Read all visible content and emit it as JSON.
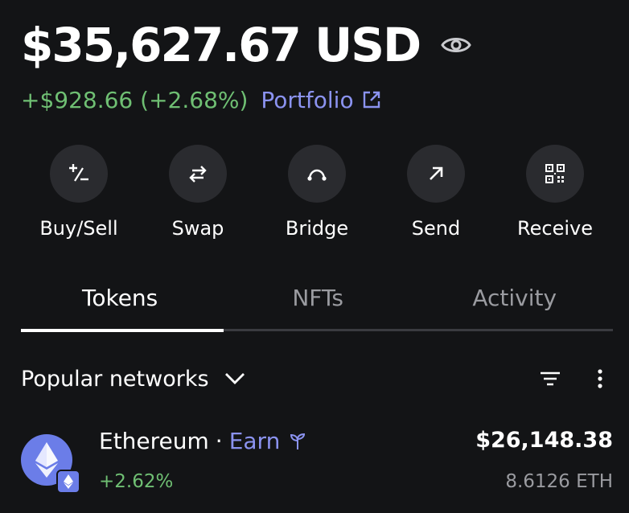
{
  "balance": {
    "amount": "$35,627.67 USD",
    "visibility_icon": "eye-icon",
    "change": "+$928.66 (+2.68%)",
    "portfolio_label": "Portfolio",
    "portfolio_icon": "external-link-icon"
  },
  "actions": [
    {
      "label": "Buy/Sell",
      "icon": "plus-minus-icon"
    },
    {
      "label": "Swap",
      "icon": "swap-arrows-icon"
    },
    {
      "label": "Bridge",
      "icon": "bridge-arc-icon"
    },
    {
      "label": "Send",
      "icon": "arrow-up-right-icon"
    },
    {
      "label": "Receive",
      "icon": "qr-code-icon"
    }
  ],
  "tabs": [
    {
      "label": "Tokens",
      "active": true
    },
    {
      "label": "NFTs",
      "active": false
    },
    {
      "label": "Activity",
      "active": false
    }
  ],
  "networks": {
    "label": "Popular networks",
    "chevron_icon": "chevron-down-icon",
    "filter_icon": "filter-icon",
    "more_icon": "more-vertical-icon"
  },
  "tokens": [
    {
      "name": "Ethereum",
      "separator": "·",
      "earn_label": "Earn",
      "earn_icon": "sprout-icon",
      "change": "+2.62%",
      "fiat_value": "$26,148.38",
      "amount": "8.6126 ETH",
      "logo_icon": "ethereum-icon"
    }
  ],
  "colors": {
    "background": "#131416",
    "positive": "#6fbf73",
    "accent": "#8b93f0",
    "muted": "#9a9ba0",
    "action_bg": "#2a2b2f",
    "eth": "#6b7de8"
  }
}
